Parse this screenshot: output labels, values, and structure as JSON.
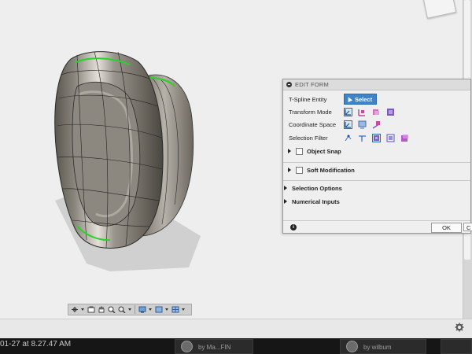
{
  "edit_form": {
    "title": "EDIT FORM",
    "tspline_entity_label": "T-Spline Entity",
    "select_label": "Select",
    "transform_mode_label": "Transform Mode",
    "coordinate_space_label": "Coordinate Space",
    "selection_filter_label": "Selection Filter",
    "object_snap_label": "Object Snap",
    "soft_modification_label": "Soft Modification",
    "selection_options_label": "Selection Options",
    "numerical_inputs_label": "Numerical Inputs",
    "ok_label": "OK",
    "cancel_label": "C"
  },
  "bottom": {
    "timestamp": "01-27 at 8.27.47 AM",
    "by_label_1": "by Ma...FIN",
    "by_label_2": "by wilbum"
  },
  "icons": [
    "viewcube-icon",
    "select-arrow-icon",
    "transform-multi-icon",
    "transform-scale-icon",
    "transform-rotate-icon",
    "transform-move-icon",
    "coord-world-icon",
    "coord-view-icon",
    "coord-local-icon",
    "filter-vertex-icon",
    "filter-edge-icon",
    "filter-face-icon",
    "filter-body-icon",
    "filter-object-icon",
    "orbit-icon",
    "pan-icon",
    "hand-icon",
    "zoom-icon",
    "zoom-window-icon",
    "display-mode-icon",
    "visual-style-icon",
    "grid-icon",
    "settings-gear-icon",
    "info-icon"
  ],
  "colors": {
    "accent": "#3d84c9",
    "highlight_edge": "#27d327",
    "panel_bg": "#efefef"
  }
}
